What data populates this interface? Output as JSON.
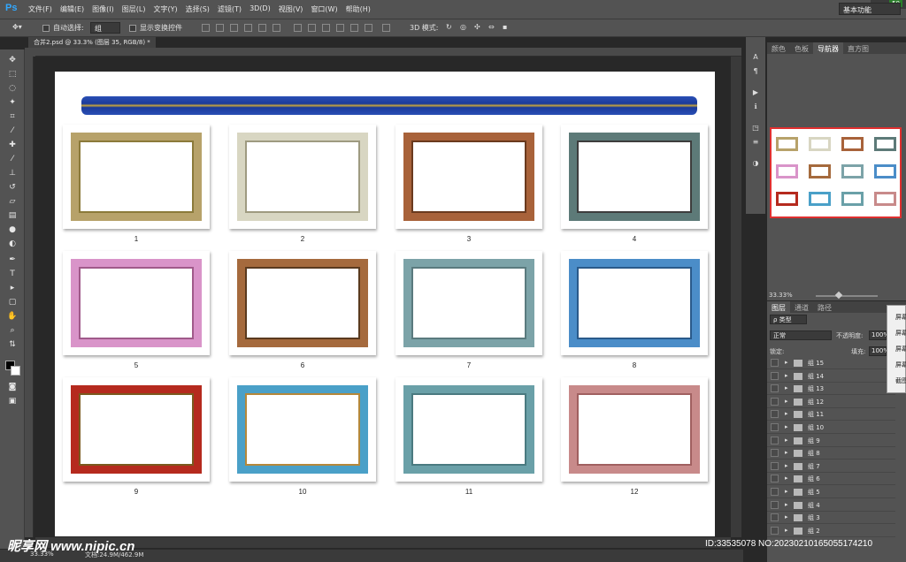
{
  "app": {
    "logo": "Ps"
  },
  "menu": [
    "文件(F)",
    "编辑(E)",
    "图像(I)",
    "图层(L)",
    "文字(Y)",
    "选择(S)",
    "滤镜(T)",
    "3D(D)",
    "视图(V)",
    "窗口(W)",
    "帮助(H)"
  ],
  "options": {
    "auto_select_label": "自动选择:",
    "auto_select_value": "组",
    "show_transform_label": "显示变换控件",
    "mode3d_label": "3D 模式:",
    "workspace": "基本功能"
  },
  "net_badge": "50",
  "document": {
    "tab_title": "合并2.psd @ 33.3% (图层 35, RGB/8) *",
    "status_zoom": "33.33%",
    "status_doc": "文档:24.9M/462.9M"
  },
  "thumbnails": [
    {
      "num": "1",
      "border": "#b7a26a",
      "inner": "#8b7a3a",
      "style": "solid"
    },
    {
      "num": "2",
      "border": "#d8d6c2",
      "inner": "#9e9a80",
      "style": "solid"
    },
    {
      "num": "3",
      "border": "#a8623a",
      "inner": "#6a3a1e",
      "style": "solid"
    },
    {
      "num": "4",
      "border": "#5d7a78",
      "inner": "#3d3d3d",
      "style": "solid"
    },
    {
      "num": "5",
      "border": "#d994c9",
      "inner": "#a05a8a",
      "style": "solid"
    },
    {
      "num": "6",
      "border": "#a56a3d",
      "inner": "#5a3a1e",
      "style": "solid"
    },
    {
      "num": "7",
      "border": "#7ca3a8",
      "inner": "#5a7a7e",
      "style": "solid"
    },
    {
      "num": "8",
      "border": "#4b8dc8",
      "inner": "#2a5a8a",
      "style": "solid"
    },
    {
      "num": "9",
      "border": "#b52a1e",
      "inner": "#7a5a1e",
      "style": "solid"
    },
    {
      "num": "10",
      "border": "#4aa0c8",
      "inner": "#b5883a",
      "style": "solid"
    },
    {
      "num": "11",
      "border": "#6aa0a8",
      "inner": "#4a7a80",
      "style": "solid"
    },
    {
      "num": "12",
      "border": "#c88a8a",
      "inner": "#a06060",
      "style": "solid"
    }
  ],
  "panels": {
    "top_tabs": [
      "颜色",
      "色板",
      "导航器",
      "直方图"
    ],
    "active_top_tab": "导航器",
    "nav_zoom": "33.33%",
    "layer_tabs": [
      "图层",
      "通道",
      "路径"
    ],
    "kind": "ρ 类型",
    "blend": "正常",
    "opacity_label": "不透明度:",
    "opacity": "100%",
    "lock_label": "锁定:",
    "fill_label": "填充:",
    "fill": "100%"
  },
  "layers": [
    "组 15",
    "组 14",
    "组 13",
    "组 12",
    "组 11",
    "组 10",
    "组 9",
    "组 8",
    "组 7",
    "组 6",
    "组 5",
    "组 4",
    "组 3",
    "组 2"
  ],
  "context_menu": [
    "屏幕",
    "屏幕",
    "屏幕",
    "屏幕",
    "截图"
  ],
  "watermark": {
    "logo": "昵享网 www.nipic.cn",
    "id": "ID:33535078 NO:20230210165055174210"
  }
}
